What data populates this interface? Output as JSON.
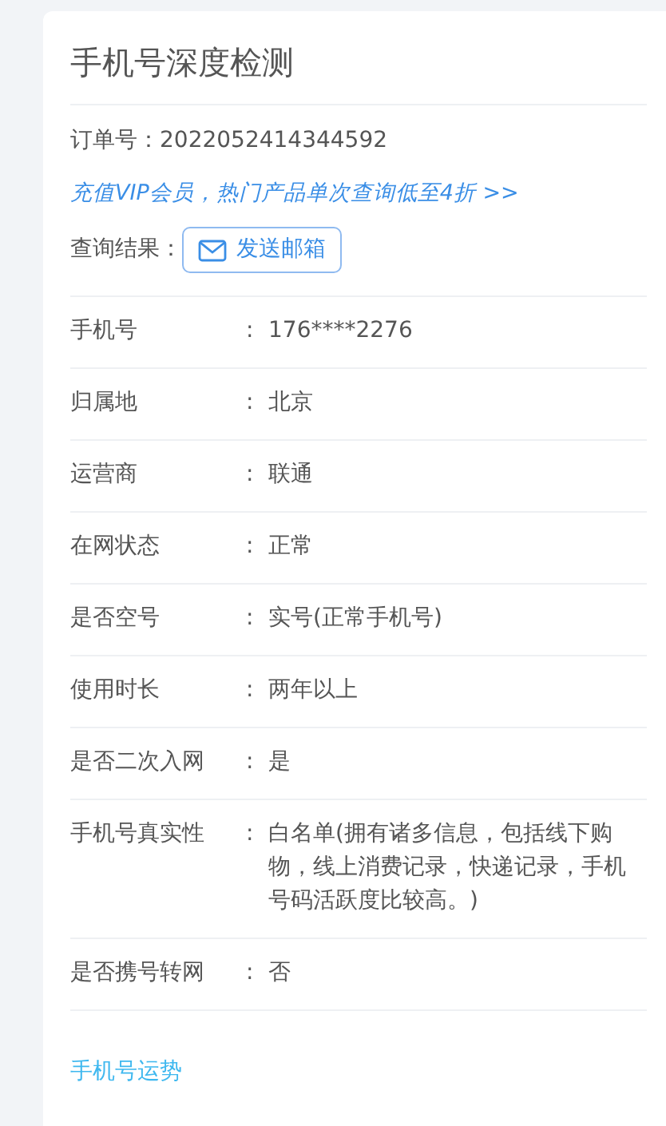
{
  "title": "手机号深度检测",
  "order": {
    "label": "订单号：",
    "value": "2022052414344592"
  },
  "promo_link": "充值VIP会员，热门产品单次查询低至4折 >>",
  "result": {
    "label": "查询结果：",
    "button": "发送邮箱"
  },
  "field_separator": ":",
  "fields": [
    {
      "label": "手机号",
      "value": "176****2276"
    },
    {
      "label": "归属地",
      "value": "北京"
    },
    {
      "label": "运营商",
      "value": "联通"
    },
    {
      "label": "在网状态",
      "value": "正常"
    },
    {
      "label": "是否空号",
      "value": "实号(正常手机号)"
    },
    {
      "label": "使用时长",
      "value": "两年以上"
    },
    {
      "label": "是否二次入网",
      "value": "是"
    },
    {
      "label": "手机号真实性",
      "value": "白名单(拥有诸多信息，包括线下购物，线上消费记录，快递记录，手机号码活跃度比较高。)"
    },
    {
      "label": "是否携号转网",
      "value": "否"
    }
  ],
  "section_link": "手机号运势"
}
